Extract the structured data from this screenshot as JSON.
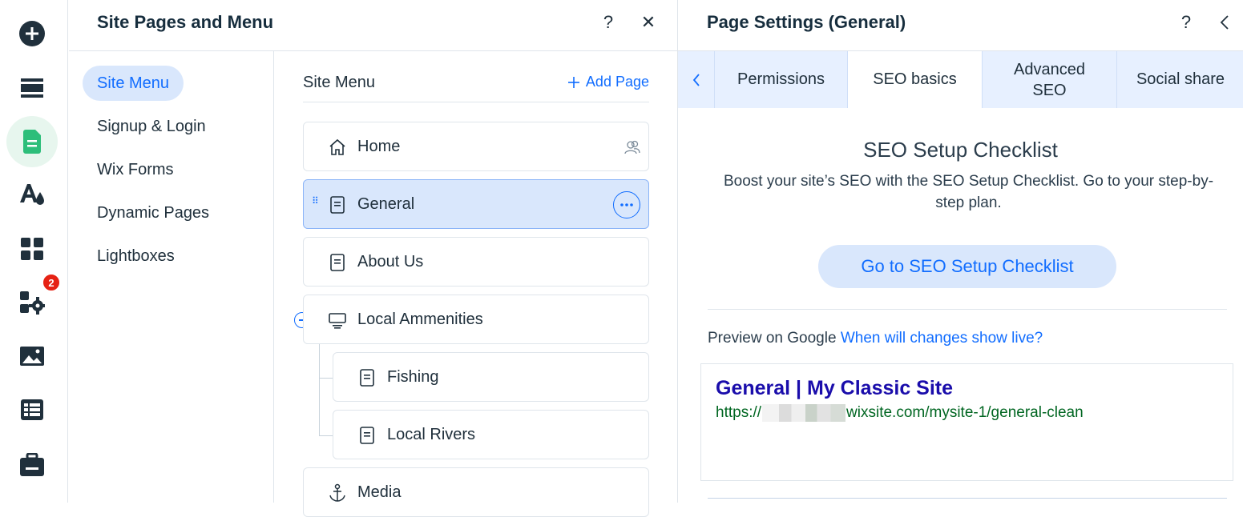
{
  "rail": {
    "items": [
      {
        "icon": "add-icon"
      },
      {
        "icon": "sections-icon"
      },
      {
        "icon": "pages-icon",
        "active": true
      },
      {
        "icon": "design-icon"
      },
      {
        "icon": "apps-icon"
      },
      {
        "icon": "business-apps-icon",
        "badge": "2"
      },
      {
        "icon": "media-icon"
      },
      {
        "icon": "cms-icon"
      },
      {
        "icon": "portfolio-icon"
      }
    ],
    "badge": "2"
  },
  "pages_panel": {
    "title": "Site Pages and Menu",
    "help_label": "?",
    "close_label": "✕",
    "categories": [
      "Site Menu",
      "Signup & Login",
      "Wix Forms",
      "Dynamic Pages",
      "Lightboxes"
    ],
    "tree_heading": "Site Menu",
    "add_page_label": "Add Page",
    "pages": [
      {
        "label": "Home",
        "icon": "home-icon"
      },
      {
        "label": "General",
        "icon": "page-icon",
        "selected": true
      },
      {
        "label": "About Us",
        "icon": "page-icon"
      },
      {
        "label": "Local Ammenities",
        "icon": "folder-icon"
      },
      {
        "label": "Fishing",
        "icon": "page-icon"
      },
      {
        "label": "Local Rivers",
        "icon": "page-icon"
      },
      {
        "label": "Media",
        "icon": "anchor-icon"
      }
    ]
  },
  "settings_panel": {
    "title": "Page Settings (General)",
    "help_label": "?",
    "tabs": [
      "Permissions",
      "SEO basics",
      "Advanced SEO",
      "Social share"
    ],
    "active_tab": "SEO basics",
    "checklist_title": "SEO Setup Checklist",
    "checklist_desc": "Boost your site’s SEO with the SEO Setup Checklist. Go to your step-by-step plan.",
    "checklist_button": "Go to SEO Setup Checklist",
    "preview_label": "Preview on Google",
    "preview_link": "When will changes show live?",
    "google_title": "General | My Classic Site",
    "google_url_prefix": "https://",
    "google_url_suffix": "wixsite.com/mysite-1/general-clean"
  },
  "colors": {
    "accent": "#116dff",
    "selected_bg": "#d9e7fc",
    "active_rail_bg": "#e7f6ee",
    "pages_icon_green": "#2dbe7a",
    "badge_red": "#e62214",
    "google_title": "#1a0dab",
    "google_url": "#006621"
  }
}
